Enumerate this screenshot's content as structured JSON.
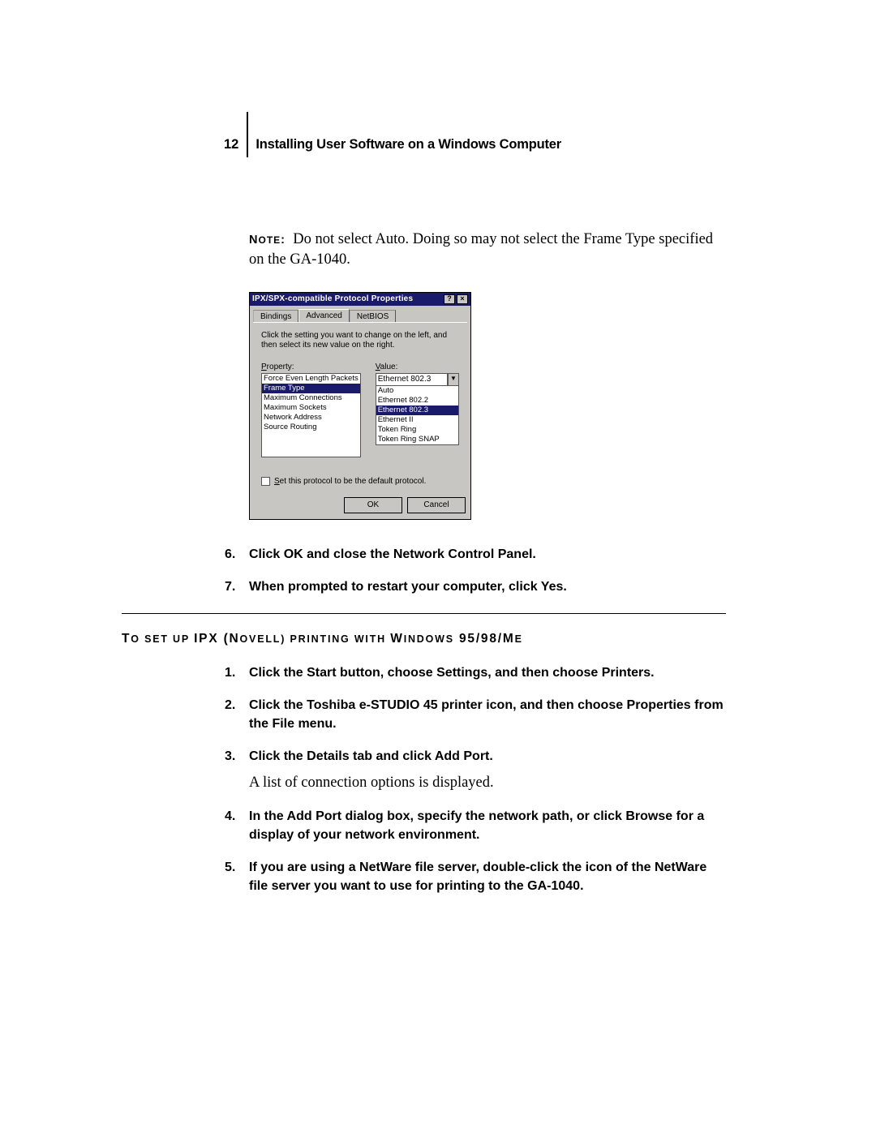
{
  "page_number": "12",
  "header_title": "Installing User Software on a Windows Computer",
  "note": {
    "label_upper": "N",
    "label_rest": "OTE",
    "colon": ":",
    "text": "Do not select Auto. Doing so may not select the Frame Type specified on the GA-1040."
  },
  "dialog": {
    "title": "IPX/SPX-compatible Protocol Properties",
    "help_btn": "?",
    "close_btn": "×",
    "tabs": {
      "bindings": "Bindings",
      "advanced": "Advanced",
      "netbios": "NetBIOS"
    },
    "instruction": "Click the setting you want to change on the left, and then select its new value on the right.",
    "property_label_u": "P",
    "property_label_rest": "roperty:",
    "value_label_u": "V",
    "value_label_rest": "alue:",
    "properties": [
      "Force Even Length Packets",
      "Frame Type",
      "Maximum Connections",
      "Maximum Sockets",
      "Network Address",
      "Source Routing"
    ],
    "property_selected": "Frame Type",
    "combo_value": "Ethernet 802.3",
    "dropdown": [
      "Auto",
      "Ethernet 802.2",
      "Ethernet 802.3",
      "Ethernet II",
      "Token Ring",
      "Token Ring SNAP"
    ],
    "dropdown_selected": "Ethernet 802.3",
    "checkbox_u": "S",
    "checkbox_rest": "et this protocol to be the default protocol.",
    "ok": "OK",
    "cancel": "Cancel"
  },
  "steps_a": {
    "6": "Click OK and close the Network Control Panel.",
    "7": "When prompted to restart your computer, click Yes."
  },
  "procedure_title": {
    "prefix": "T",
    "rest1": "O SET UP ",
    "ipx": "IPX (N",
    "rest2": "OVELL",
    "rest3": ") PRINTING WITH ",
    "win": "W",
    "rest4": "INDOWS",
    "ver": " 95/98/M",
    "e": "E"
  },
  "steps_b": {
    "1": "Click the Start button, choose Settings, and then choose Printers.",
    "2": "Click the Toshiba e-STUDIO 45 printer icon, and then choose Properties from the File menu.",
    "3": "Click the Details tab and click Add Port.",
    "3_sub": "A list of connection options is displayed.",
    "4": "In the Add Port dialog box, specify the network path, or click Browse for a display of your network environment.",
    "5": "If you are using a NetWare file server, double-click the icon of the NetWare file server you want to use for printing to the GA-1040."
  }
}
